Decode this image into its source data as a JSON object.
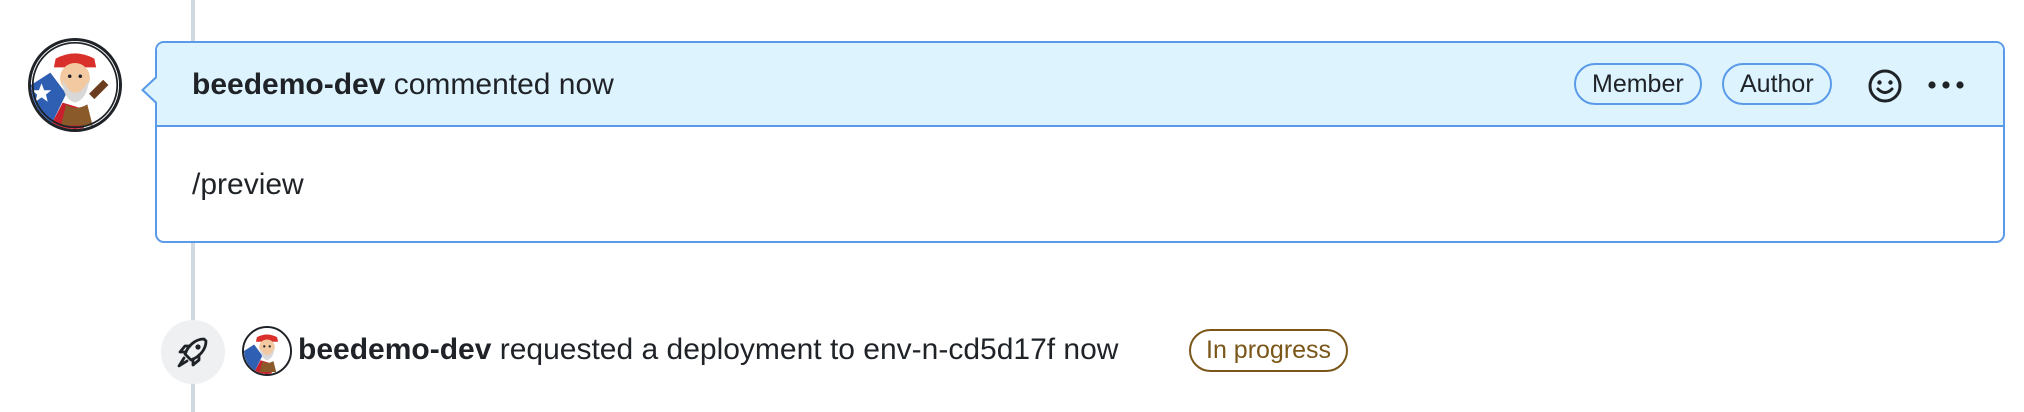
{
  "comment": {
    "author": "beedemo-dev",
    "action": "commented now",
    "labels": [
      "Member",
      "Author"
    ],
    "body": "/preview",
    "icons": {
      "reaction": "smiley-icon",
      "menu": "kebab-horizontal-icon"
    }
  },
  "deployment_event": {
    "icon": "rocket-icon",
    "author": "beedemo-dev",
    "text": "requested a deployment to env-n-cd5d17f now",
    "status": "In progress",
    "status_color": "#7a5618"
  },
  "colors": {
    "accent_border": "#5b9ae8",
    "header_bg": "#ddf4ff",
    "timeline": "#d1d9e0"
  }
}
